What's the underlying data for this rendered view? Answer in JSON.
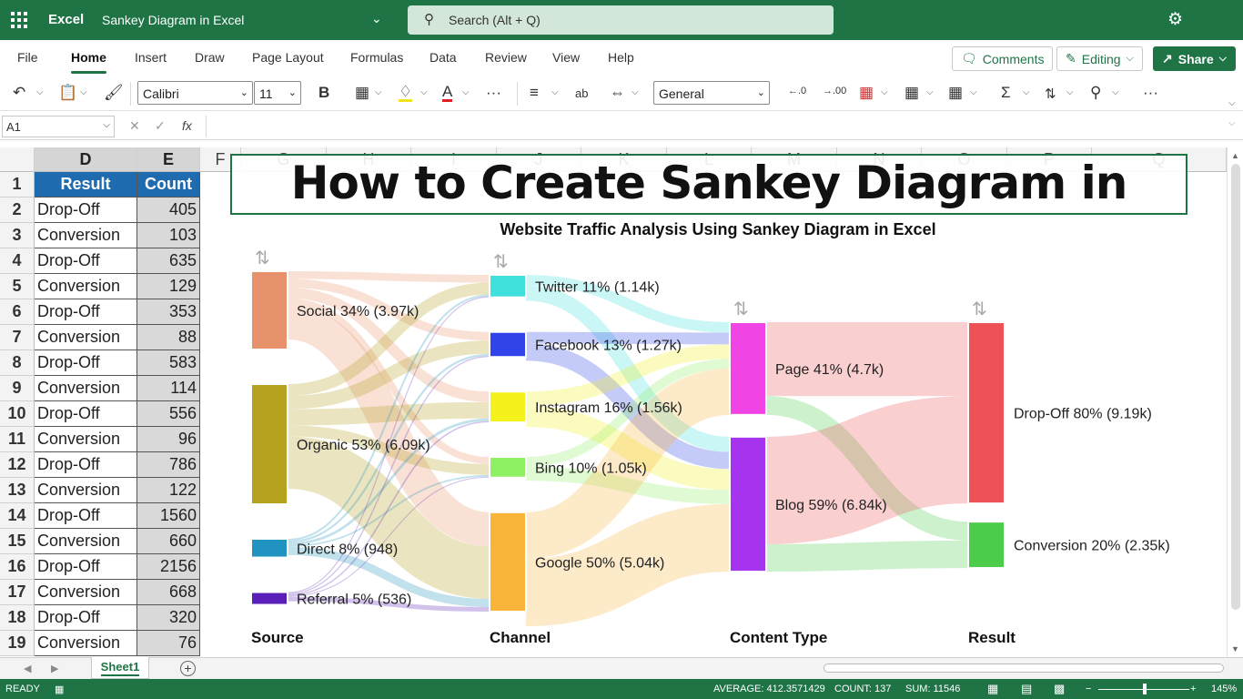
{
  "titlebar": {
    "app": "Excel",
    "doc": "Sankey Diagram in Excel",
    "search_placeholder": "Search (Alt + Q)"
  },
  "menu": [
    "File",
    "Home",
    "Insert",
    "Draw",
    "Page Layout",
    "Formulas",
    "Data",
    "Review",
    "View",
    "Help"
  ],
  "menu_active": "Home",
  "ribbon_buttons": {
    "comments": "Comments",
    "editing": "Editing",
    "share": "Share"
  },
  "ribbon": {
    "font": "Calibri",
    "size": "11",
    "number_format": "General"
  },
  "formula_bar": {
    "name_box": "A1",
    "fx": "fx",
    "value": ""
  },
  "columns": [
    "D",
    "E",
    "F",
    "G",
    "H",
    "I",
    "J",
    "K",
    "L",
    "M",
    "N",
    "O",
    "P",
    "Q"
  ],
  "table": {
    "headers": [
      "Result",
      "Count"
    ],
    "rows": [
      [
        "Drop-Off",
        "405"
      ],
      [
        "Conversion",
        "103"
      ],
      [
        "Drop-Off",
        "635"
      ],
      [
        "Conversion",
        "129"
      ],
      [
        "Drop-Off",
        "353"
      ],
      [
        "Conversion",
        "88"
      ],
      [
        "Drop-Off",
        "583"
      ],
      [
        "Conversion",
        "114"
      ],
      [
        "Drop-Off",
        "556"
      ],
      [
        "Conversion",
        "96"
      ],
      [
        "Drop-Off",
        "786"
      ],
      [
        "Conversion",
        "122"
      ],
      [
        "Drop-Off",
        "1560"
      ],
      [
        "Conversion",
        "660"
      ],
      [
        "Drop-Off",
        "2156"
      ],
      [
        "Conversion",
        "668"
      ],
      [
        "Drop-Off",
        "320"
      ],
      [
        "Conversion",
        "76"
      ]
    ],
    "row_numbers": [
      "1",
      "2",
      "3",
      "4",
      "5",
      "6",
      "7",
      "8",
      "9",
      "10",
      "11",
      "12",
      "13",
      "14",
      "15",
      "16",
      "17",
      "18",
      "19"
    ]
  },
  "overlay_title": "How to Create Sankey Diagram in Excel?",
  "chart_data": {
    "type": "sankey",
    "title": "Website Traffic Analysis Using Sankey Diagram in Excel",
    "stages": [
      "Source",
      "Channel",
      "Content Type",
      "Result"
    ],
    "nodes": [
      {
        "stage": 0,
        "label": "Social 34% (3.97k)",
        "value": 3970,
        "color": "#e8926c"
      },
      {
        "stage": 0,
        "label": "Organic 53% (6.09k)",
        "value": 6090,
        "color": "#b5a21e"
      },
      {
        "stage": 0,
        "label": "Direct 8% (948)",
        "value": 948,
        "color": "#2093c0"
      },
      {
        "stage": 0,
        "label": "Referral 5% (536)",
        "value": 536,
        "color": "#5a1fb8"
      },
      {
        "stage": 1,
        "label": "Twitter 11% (1.14k)",
        "value": 1140,
        "color": "#40e0dc"
      },
      {
        "stage": 1,
        "label": "Facebook 13% (1.27k)",
        "value": 1270,
        "color": "#3044ea"
      },
      {
        "stage": 1,
        "label": "Instagram 16% (1.56k)",
        "value": 1560,
        "color": "#f4f21a"
      },
      {
        "stage": 1,
        "label": "Bing 10% (1.05k)",
        "value": 1050,
        "color": "#8ef065"
      },
      {
        "stage": 1,
        "label": "Google 50% (5.04k)",
        "value": 5040,
        "color": "#f8b53a"
      },
      {
        "stage": 2,
        "label": "Page 41% (4.7k)",
        "value": 4700,
        "color": "#f044e4"
      },
      {
        "stage": 2,
        "label": "Blog 59% (6.84k)",
        "value": 6840,
        "color": "#a634ee"
      },
      {
        "stage": 3,
        "label": "Drop-Off 80% (9.19k)",
        "value": 9190,
        "color": "#ee5256"
      },
      {
        "stage": 3,
        "label": "Conversion 20% (2.35k)",
        "value": 2350,
        "color": "#4ccc4a"
      }
    ]
  },
  "sheet_tab": "Sheet1",
  "status": {
    "ready": "READY",
    "average": "AVERAGE: 412.3571429",
    "count": "COUNT: 137",
    "sum": "SUM: 11546",
    "zoom": "145%"
  },
  "colors": {
    "brand": "#1f7446",
    "header_fill": "#1f6bb0"
  }
}
